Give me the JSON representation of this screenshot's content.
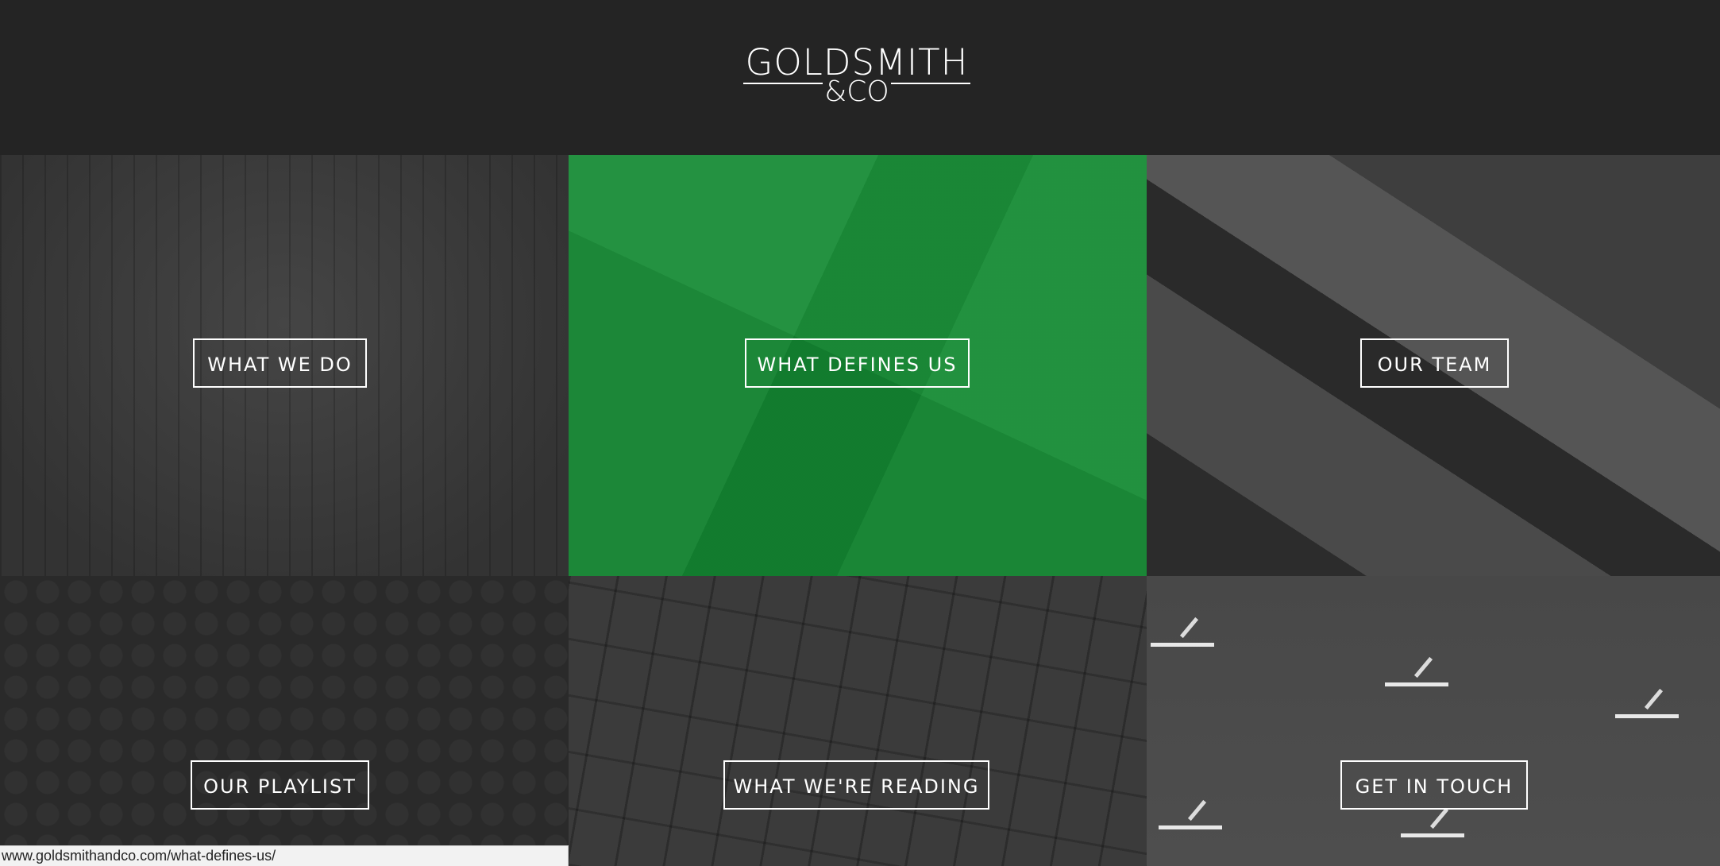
{
  "header": {
    "logo_main": "GOLDSMITH",
    "logo_sub": "&CO"
  },
  "tiles": [
    {
      "label": "WHAT WE DO",
      "image": "silo-photo"
    },
    {
      "label": "WHAT DEFINES US",
      "image": "green-overlay"
    },
    {
      "label": "OUR TEAM",
      "image": "fabric-photo"
    },
    {
      "label": "OUR PLAYLIST",
      "image": "dark-texture"
    },
    {
      "label": "WHAT WE'RE READING",
      "image": "building-photo"
    },
    {
      "label": "GET IN TOUCH",
      "image": "snow-chairs-photo"
    }
  ],
  "status_bar": {
    "url": "www.goldsmithandco.com/what-defines-us/"
  },
  "colors": {
    "header_bg": "#242424",
    "accent_green": "#148a33",
    "button_border": "#ffffff"
  }
}
